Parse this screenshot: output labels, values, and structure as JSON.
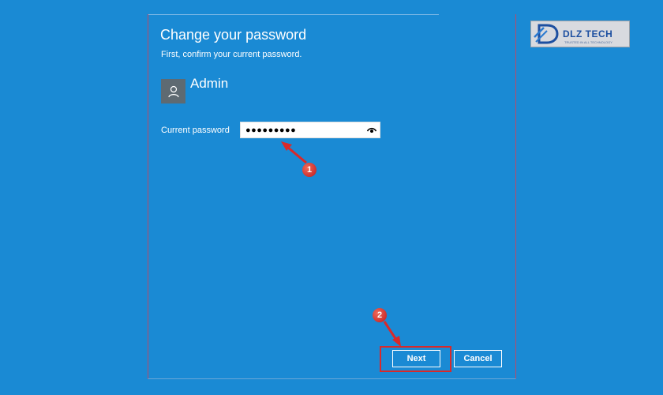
{
  "dialog": {
    "title": "Change your password",
    "subtitle": "First, confirm your current password.",
    "user": {
      "name": "Admin",
      "avatar_icon": "user-icon"
    },
    "field": {
      "label": "Current password",
      "value": "●●●●●●●●●",
      "reveal_icon": "eye-icon"
    },
    "buttons": {
      "next": "Next",
      "cancel": "Cancel"
    }
  },
  "logo": {
    "text": "DLZ TECH",
    "tagline": "TRUSTED IN ALL TECHNOLOGY"
  },
  "annotations": [
    {
      "label": "1"
    },
    {
      "label": "2"
    }
  ],
  "colors": {
    "background": "#1a8ad4",
    "highlight": "#d9292a",
    "avatar_bg": "#5e6a72"
  }
}
